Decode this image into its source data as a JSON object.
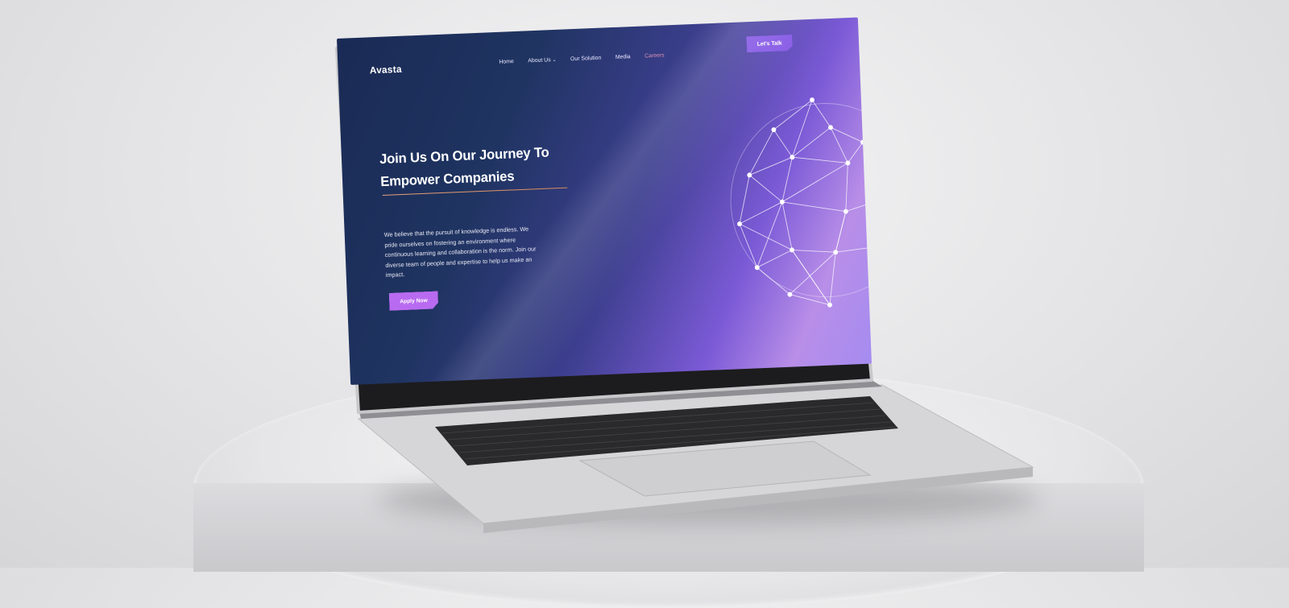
{
  "site": {
    "brand": "Avasta",
    "nav": {
      "items": [
        {
          "label": "Home"
        },
        {
          "label": "About Us"
        },
        {
          "label": "Our Solution"
        },
        {
          "label": "Media"
        },
        {
          "label": "Careers"
        }
      ],
      "cta_label": "Let's Talk"
    },
    "hero": {
      "title_line1": "Join Us On Our Journey To",
      "title_line2": "Empower Companies",
      "body": "We believe that the pursuit of knowledge is endless. We pride ourselves on fostering an environment where continuous learning and collaboration is the norm. Join our diverse team of people and expertise to help us make an impact.",
      "button_label": "Apply Now"
    }
  },
  "colors": {
    "background_dark": "#1a2a55",
    "gradient_purple": "#7b5ad6",
    "gradient_light": "#b88ee8",
    "cta": "#8a5ee6",
    "apply_button": "#b86bf0",
    "active_nav": "#d98fb4",
    "underline": "#e8a17a"
  },
  "icons": [
    "chevron-down-icon",
    "wireframe-globe-graphic"
  ]
}
